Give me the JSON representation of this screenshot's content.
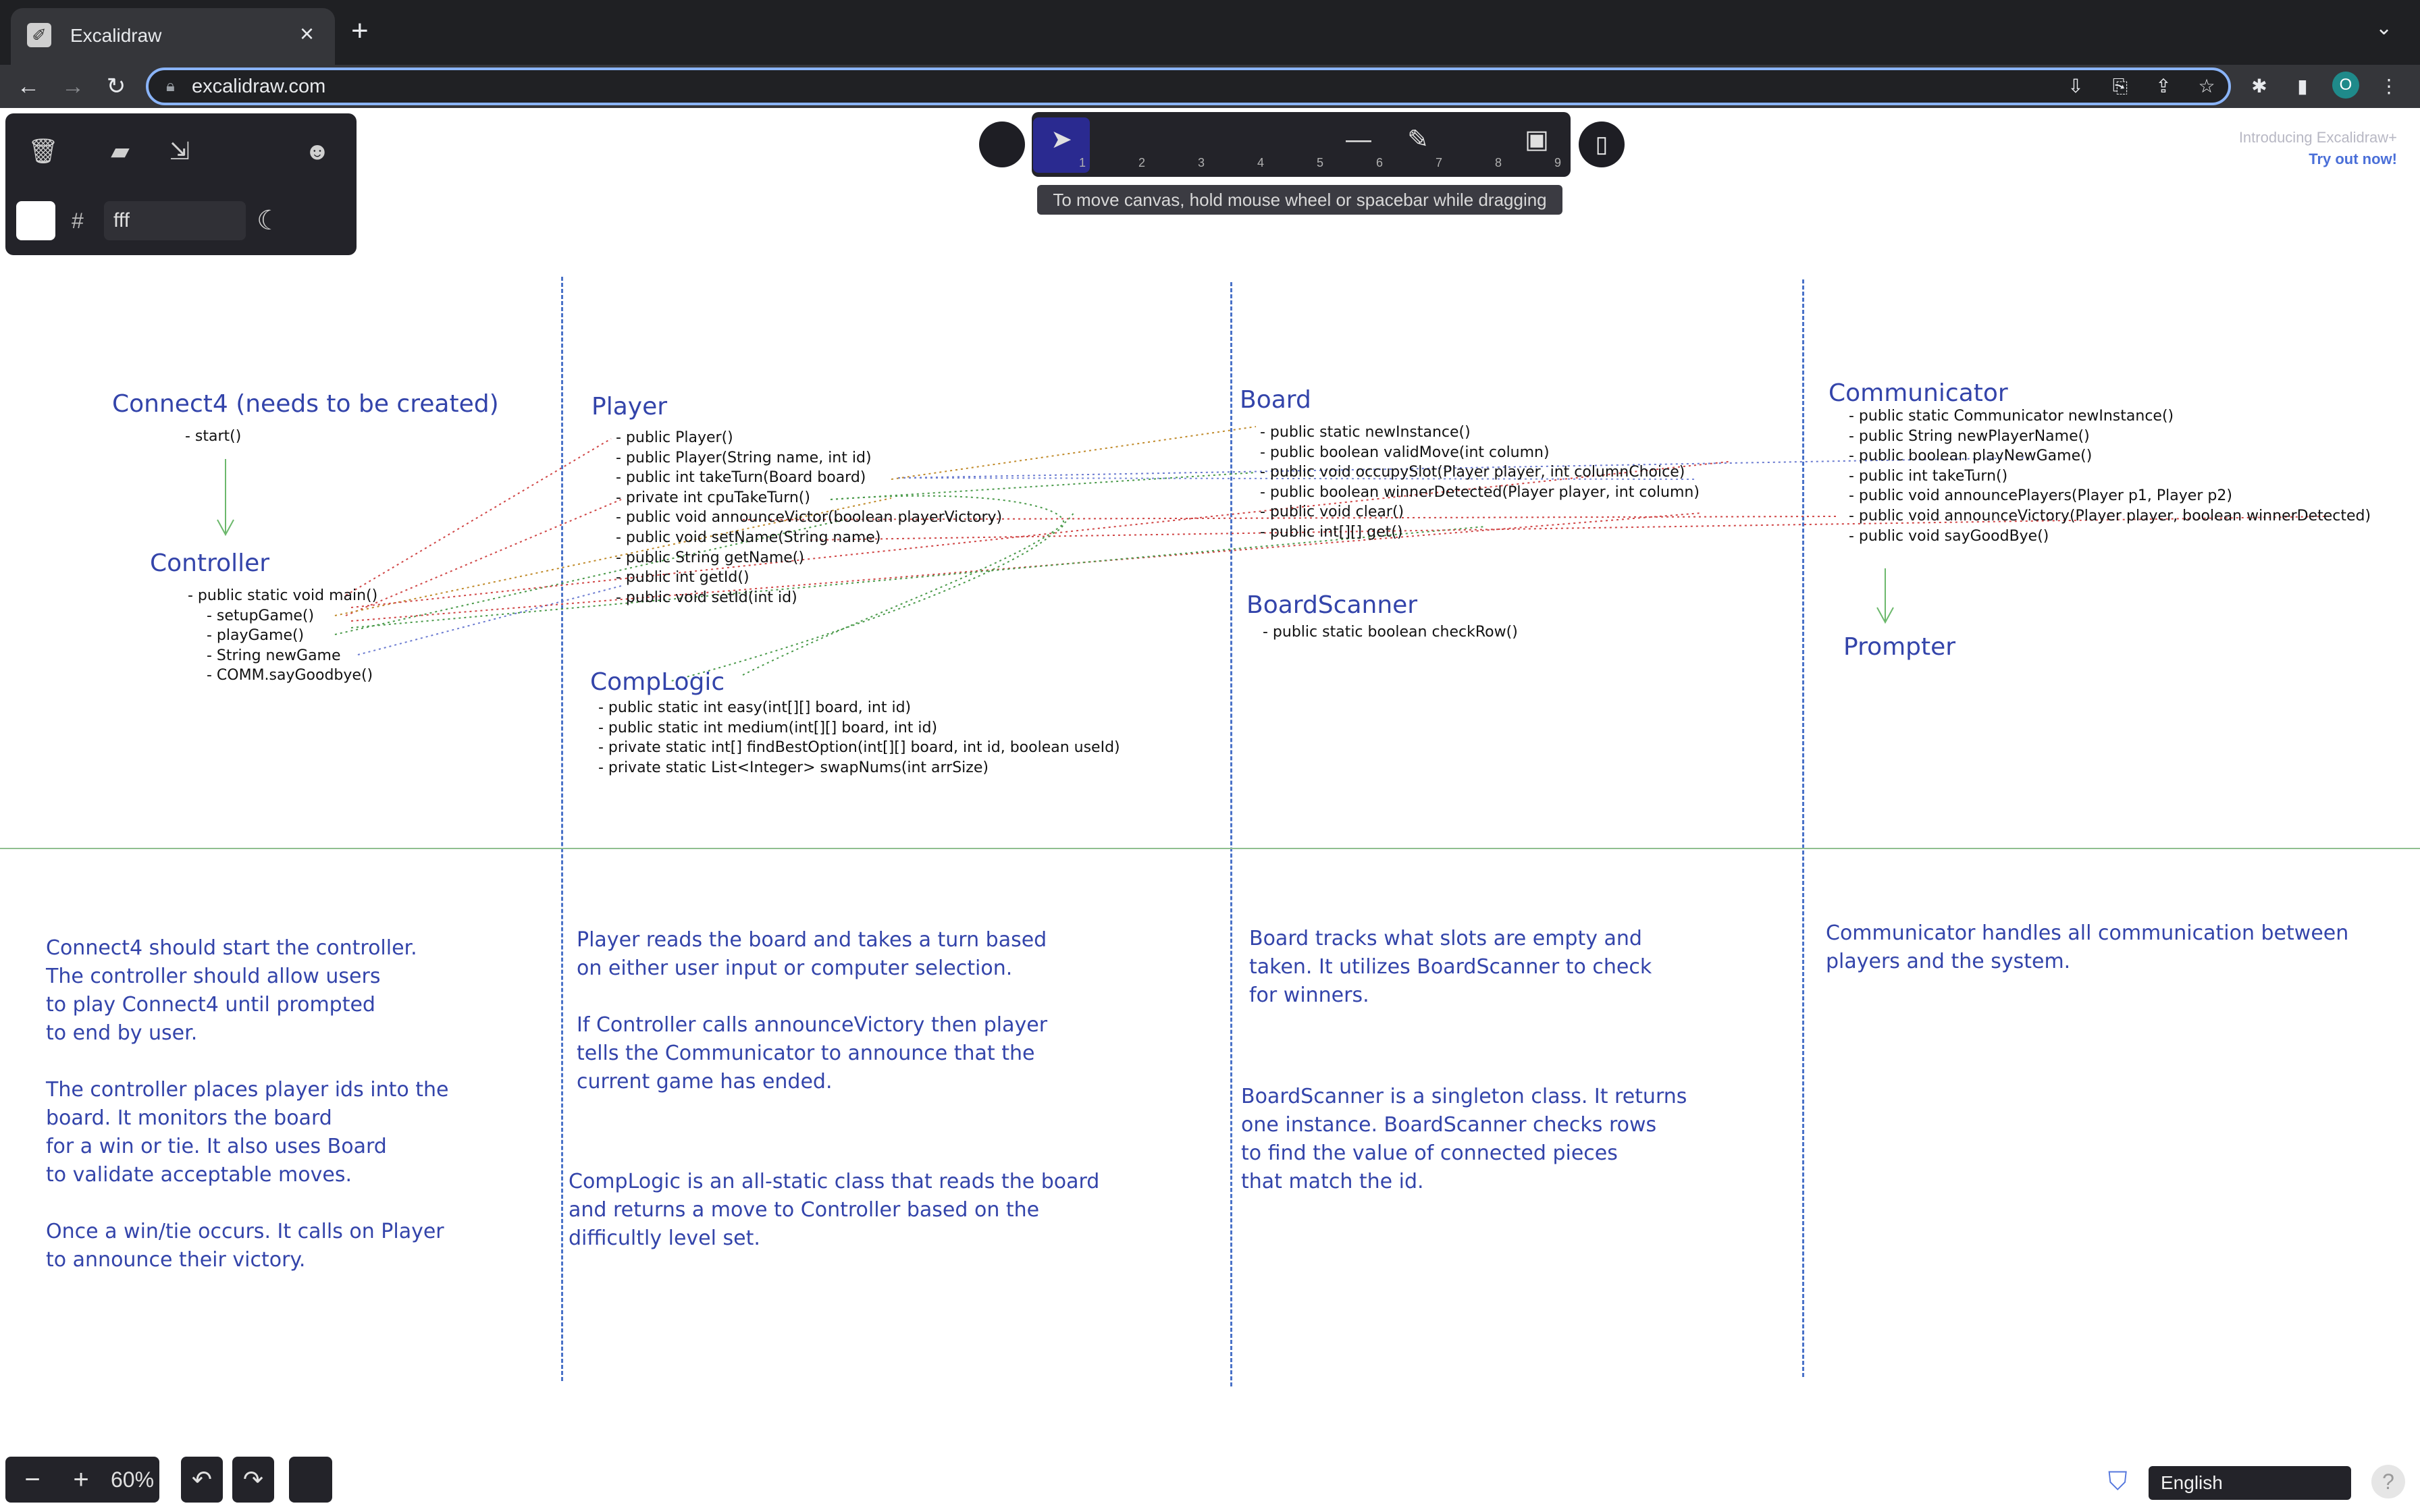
{
  "browser": {
    "tab_title": "Excalidraw",
    "tab_favicon": "excalidraw-favicon",
    "close_tab_glyph": "×",
    "new_tab_glyph": "+",
    "url": "excalidraw.com"
  },
  "menu": {
    "bg_hash": "#",
    "bg_value": "fff"
  },
  "tools": [
    {
      "name": "selection",
      "glyph": "➤",
      "key": "1"
    },
    {
      "name": "rectangle",
      "glyph": "",
      "key": "2"
    },
    {
      "name": "diamond",
      "glyph": "",
      "key": "3"
    },
    {
      "name": "ellipse",
      "glyph": "",
      "key": "4"
    },
    {
      "name": "arrow",
      "glyph": "",
      "key": "5"
    },
    {
      "name": "line",
      "glyph": "—",
      "key": "6"
    },
    {
      "name": "draw",
      "glyph": "✎",
      "key": "7"
    },
    {
      "name": "text",
      "glyph": "",
      "key": "8"
    },
    {
      "name": "image",
      "glyph": "▣",
      "key": "9"
    }
  ],
  "hint": "To move canvas, hold mouse wheel or spacebar while dragging",
  "promo": {
    "title": "Introducing Excalidraw+",
    "link": "Try out now!"
  },
  "diagram": {
    "connect4": {
      "title": "Connect4 (needs to be created)",
      "methods": "- start()"
    },
    "controller": {
      "title": "Controller",
      "methods": "- public static void main()\n    - setupGame()\n    - playGame()\n    - String newGame\n    - COMM.sayGoodbye()"
    },
    "player": {
      "title": "Player",
      "methods": "- public Player()\n- public Player(String name, int id)\n- public int takeTurn(Board board)\n- private int cpuTakeTurn()\n- public void announceVictor(boolean playerVictory)\n- public void setName(String name)\n- public String getName()\n- public int getId()\n- public void setId(int id)"
    },
    "complogic": {
      "title": "CompLogic",
      "methods": "- public static int easy(int[][] board, int id)\n- public static int medium(int[][] board, int id)\n- private static int[] findBestOption(int[][] board, int id, boolean useId)\n- private static List<Integer> swapNums(int arrSize)"
    },
    "board": {
      "title": "Board",
      "methods": "- public static newInstance()\n- public boolean validMove(int column)\n- public void occupySlot(Player player, int columnChoice)\n- public boolean winnerDetected(Player player, int column)\n- public void clear()\n- public int[][] get()"
    },
    "boardscanner": {
      "title": "BoardScanner",
      "methods": "- public static boolean checkRow()"
    },
    "communicator": {
      "title": "Communicator",
      "methods": "- public static Communicator newInstance()\n- public String newPlayerName()\n- public boolean playNewGame()\n- public int takeTurn()\n- public void announcePlayers(Player p1, Player p2)\n- public void announceVictory(Player player, boolean winnerDetected)\n- public void sayGoodBye()"
    },
    "prompter": {
      "title": "Prompter"
    }
  },
  "notes": {
    "col1": "Connect4 should start the controller.\nThe controller should allow users\nto play Connect4 until prompted\nto end by user.\n\nThe controller places player ids into the\nboard. It monitors the board\nfor a win or tie. It also uses Board\nto validate acceptable moves.\n\nOnce a win/tie occurs. It calls on Player\nto announce their victory.",
    "col2a": "Player reads the board and takes a turn based\non either user input or computer selection.\n\nIf Controller calls announceVictory then player\ntells the Communicator to announce that the\ncurrent game has ended.",
    "col2b": "CompLogic is an all-static class that reads the board\nand returns a move to Controller based on the\ndifficultly level set.",
    "col3a": "Board tracks what slots are empty and\ntaken. It utilizes BoardScanner to check\nfor winners.",
    "col3b": "BoardScanner is a singleton class. It returns\none instance. BoardScanner checks rows\nto find the value of connected pieces\nthat match the id.",
    "col4": "Communicator handles all communication between\nplayers and the system."
  },
  "bottom": {
    "zoom_out": "−",
    "zoom_level": "60%",
    "zoom_in": "+",
    "language": "English"
  }
}
